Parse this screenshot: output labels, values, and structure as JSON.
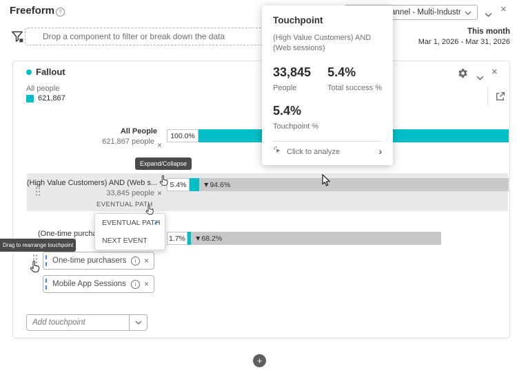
{
  "header": {
    "title": "Freeform",
    "workspace_selector": "Omni-Channel - Multi-Industry"
  },
  "filter_bar": {
    "dropzone": "Drop a component to filter or break down the data",
    "period_label": "This month",
    "period_range": "Mar 1, 2026 - Mar 31, 2026"
  },
  "popover": {
    "title": "Touchpoint",
    "subtitle": "(High Value Customers) AND (Web sessions)",
    "people_value": "33,845",
    "people_label": "People",
    "success_value": "5.4%",
    "success_label": "Total success %",
    "touchpoint_value": "5.4%",
    "touchpoint_label": "Touchpoint %",
    "analyze": "Click to analyze"
  },
  "panel": {
    "title": "Fallout",
    "legend_label": "All people",
    "legend_value": "621,867",
    "colors": {
      "teal": "#00bfc6",
      "bar_gray": "#c8c8c8",
      "accent_blue": "#1473e6"
    }
  },
  "fallout": {
    "rows": [
      {
        "name": "All People",
        "people": "621,867 people",
        "rate": "100.0%",
        "fallout": ""
      },
      {
        "name": "(High Value Customers) AND (Web s...",
        "people": "33,845 people",
        "rate": "5.4%",
        "fallout": "▼94.6%"
      },
      {
        "name": "(One-time purcha",
        "people": "",
        "rate": "1.7%",
        "fallout": "▼68.2%"
      }
    ],
    "path_label": "EVENTUAL PATH",
    "menu_items": [
      "EVENTUAL PATH",
      "NEXT EVENT"
    ],
    "expand_tooltip": "Expand/Collapse",
    "drag_tooltip": "Drag to rearrange touchpoint",
    "touchpoints": [
      "One-time purchasers",
      "Mobile App Sessions"
    ],
    "add_placeholder": "Add touchpoint"
  },
  "icons": {
    "help": "?",
    "hamburger": "≡",
    "close": "×",
    "check": "✓",
    "plus": "+",
    "chevron_right": "›",
    "info": "i"
  }
}
